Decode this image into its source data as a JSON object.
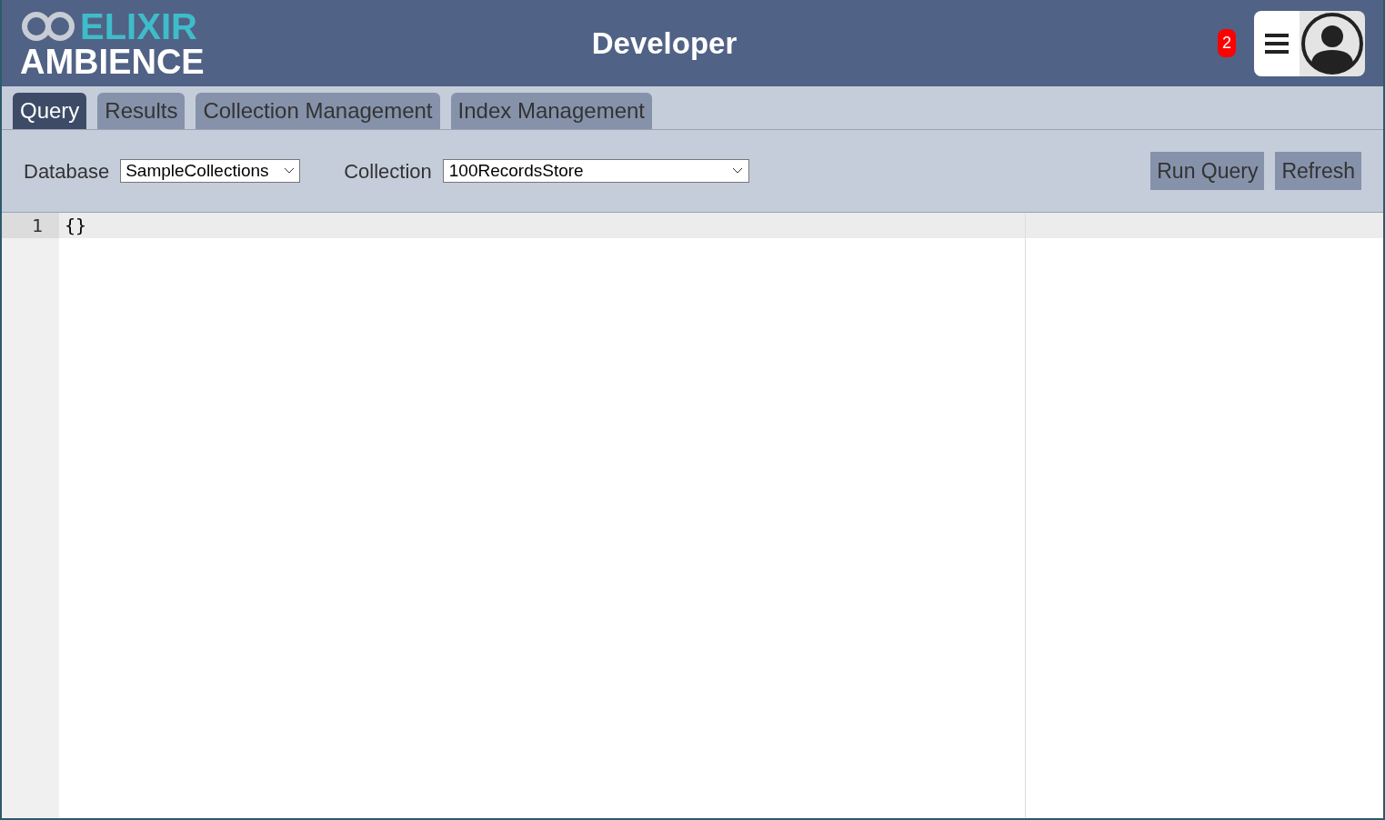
{
  "header": {
    "logo_top": "ELIXIR",
    "logo_bottom": "AMBIENCE",
    "title": "Developer",
    "notification_count": "2"
  },
  "tabs": [
    {
      "label": "Query",
      "selected": true
    },
    {
      "label": "Results",
      "selected": false
    },
    {
      "label": "Collection Management",
      "selected": false
    },
    {
      "label": "Index Management",
      "selected": false
    }
  ],
  "toolbar": {
    "database_label": "Database",
    "database_value": "SampleCollections",
    "collection_label": "Collection",
    "collection_value": "100RecordsStore",
    "buttons": [
      "Run Query",
      "Refresh"
    ]
  },
  "editor": {
    "lines": [
      {
        "number": "1",
        "text": "{}"
      }
    ]
  }
}
